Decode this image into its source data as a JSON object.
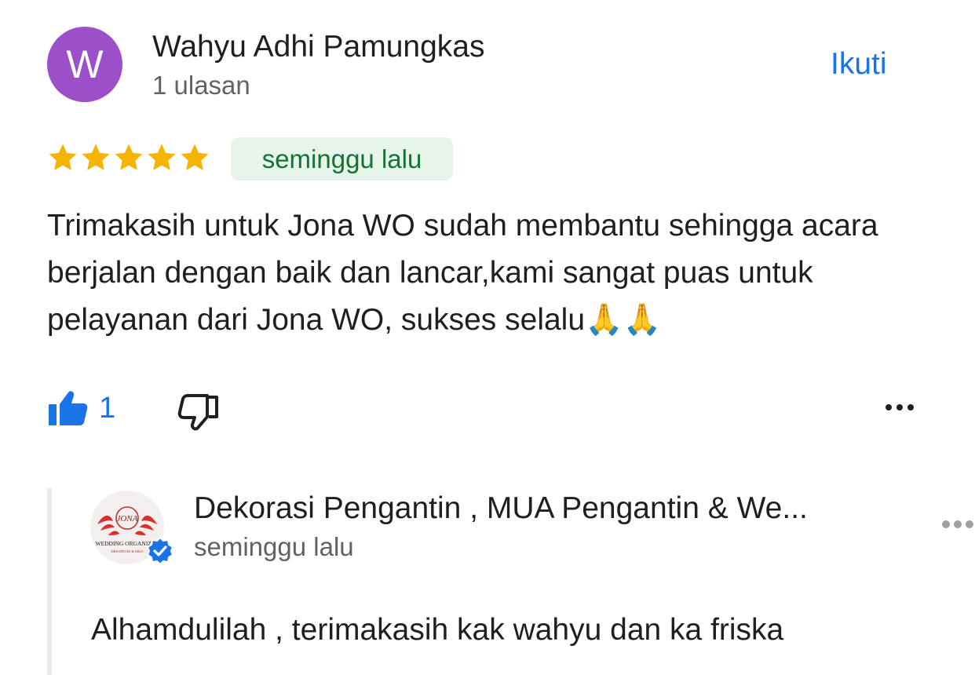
{
  "review": {
    "reviewer": {
      "avatar_letter": "W",
      "avatar_color": "#9c4fc8",
      "name": "Wahyu Adhi Pamungkas",
      "meta": "1 ulasan"
    },
    "follow_label": "Ikuti",
    "rating": 5,
    "rating_max": 5,
    "time_badge": "seminggu lalu",
    "text": "Trimakasih untuk Jona WO sudah membantu sehingga acara berjalan dengan baik dan lancar,kami sangat puas untuk pelayanan dari Jona WO, sukses selalu🙏🙏",
    "like_count": "1",
    "icons": {
      "like": "thumbs-up-icon",
      "dislike": "thumbs-down-icon",
      "more": "more-horizontal-icon"
    }
  },
  "owner_reply": {
    "logo_icon": "business-logo",
    "logo_text": {
      "brand": "JONA",
      "line1": "WEDDING ORGANIZER",
      "line2": "DEKORASI & MUA"
    },
    "name": "Dekorasi Pengantin , MUA Pengantin & We...",
    "time": "seminggu lalu",
    "text": "Alhamdulilah , terimakasih kak wahyu dan ka friska"
  },
  "colors": {
    "accent": "#1a73e8",
    "star": "#f4b400",
    "badge_bg": "#e6f4ea",
    "badge_text": "#137333",
    "muted_text": "#5f6368"
  }
}
